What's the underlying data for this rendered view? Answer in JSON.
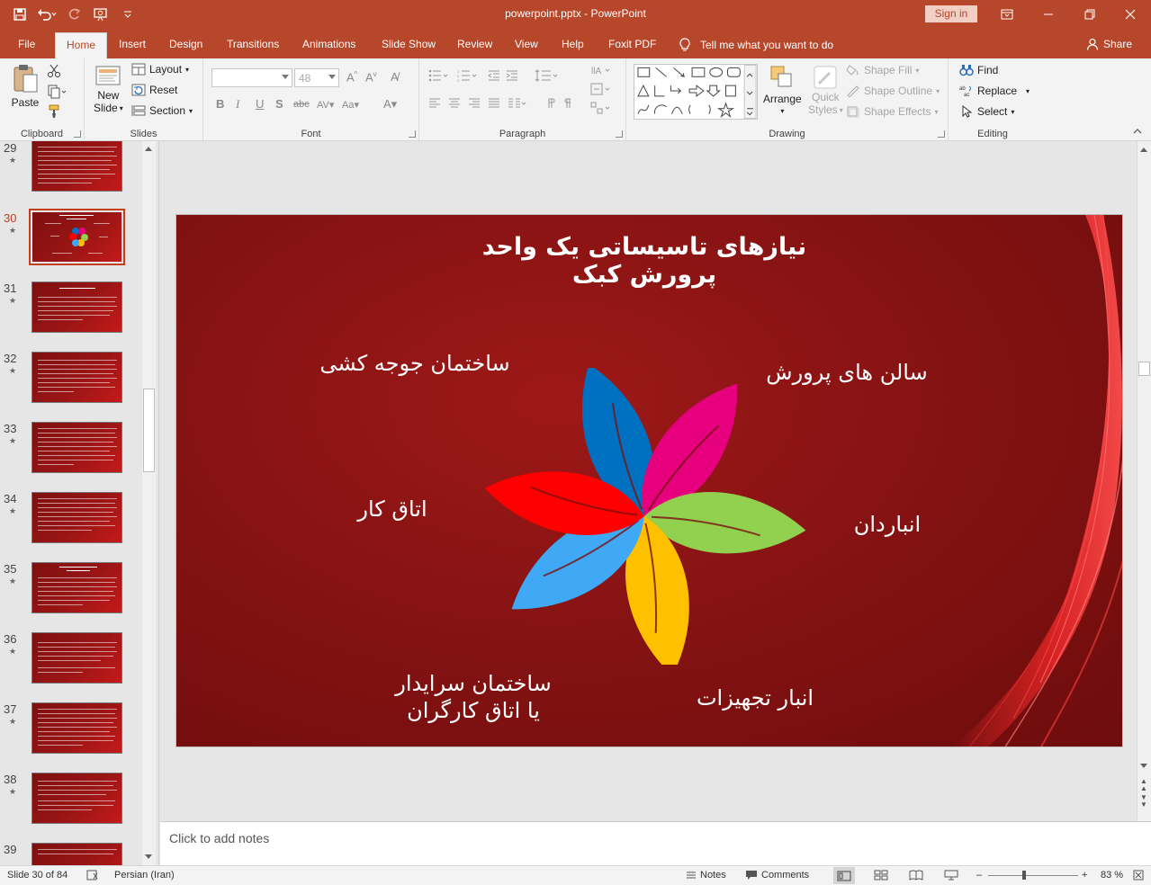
{
  "app": {
    "document_title": "powerpoint.pptx  -  PowerPoint",
    "sign_in": "Sign in",
    "tell_me": "Tell me what you want to do",
    "share": "Share"
  },
  "tabs": [
    "File",
    "Home",
    "Insert",
    "Design",
    "Transitions",
    "Animations",
    "Slide Show",
    "Review",
    "View",
    "Help",
    "Foxit PDF"
  ],
  "ribbon": {
    "clipboard": {
      "label": "Clipboard",
      "paste": "Paste"
    },
    "slides": {
      "label": "Slides",
      "new_slide_1": "New",
      "new_slide_2": "Slide",
      "layout": "Layout",
      "reset": "Reset",
      "section": "Section"
    },
    "font": {
      "label": "Font",
      "font_size": "48"
    },
    "paragraph": {
      "label": "Paragraph"
    },
    "drawing": {
      "label": "Drawing",
      "arrange": "Arrange",
      "quick_styles_1": "Quick",
      "quick_styles_2": "Styles",
      "shape_fill": "Shape Fill",
      "shape_outline": "Shape Outline",
      "shape_effects": "Shape Effects"
    },
    "editing": {
      "label": "Editing",
      "find": "Find",
      "replace": "Replace",
      "select": "Select"
    }
  },
  "thumbnails": [
    {
      "num": "29",
      "current": false
    },
    {
      "num": "30",
      "current": true
    },
    {
      "num": "31",
      "current": false
    },
    {
      "num": "32",
      "current": false
    },
    {
      "num": "33",
      "current": false
    },
    {
      "num": "34",
      "current": false
    },
    {
      "num": "35",
      "current": false
    },
    {
      "num": "36",
      "current": false
    },
    {
      "num": "37",
      "current": false
    },
    {
      "num": "38",
      "current": false
    },
    {
      "num": "39",
      "current": false
    }
  ],
  "slide": {
    "title_line1": "نیازهای تاسیساتی یک واحد",
    "title_line2": "پرورش کبک",
    "labels": {
      "chick_building": "ساختمان جوجه کشی",
      "rearing_halls": "سالن های پرورش",
      "work_room": "اتاق کار",
      "warehouse_keeper": "انباردان",
      "caretaker_line1": "ساختمان سرایدار",
      "caretaker_line2": "یا اتاق کارگران",
      "equipment_store": "انبار تجهیزات"
    },
    "petal_colors": [
      "#0070c0",
      "#e6007e",
      "#92d050",
      "#ffc000",
      "#3fa9f5",
      "#ff0000"
    ]
  },
  "notes": {
    "placeholder": "Click to add notes"
  },
  "status": {
    "slide_info": "Slide 30 of 84",
    "language": "Persian (Iran)",
    "notes": "Notes",
    "comments": "Comments",
    "zoom": "83 %"
  }
}
